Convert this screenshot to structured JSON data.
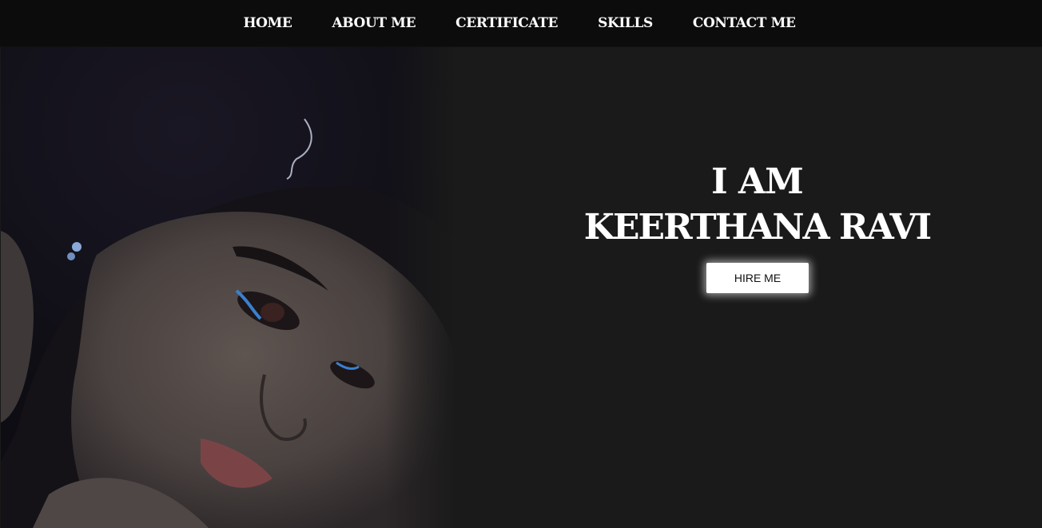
{
  "nav": {
    "items": [
      {
        "label": "HOME"
      },
      {
        "label": "ABOUT ME"
      },
      {
        "label": "CERTIFICATE"
      },
      {
        "label": "SKILLS"
      },
      {
        "label": "CONTACT ME"
      }
    ]
  },
  "hero": {
    "headline_line1": "I AM",
    "headline_line2": "KEERTHANA RAVI",
    "hire_button_label": "HIRE ME",
    "portrait_icon": "portrait-photo"
  },
  "colors": {
    "background": "#1a1a1a",
    "navbar": "#0c0c0c",
    "text": "#ffffff",
    "button_bg": "#ffffff",
    "button_text": "#111111"
  }
}
